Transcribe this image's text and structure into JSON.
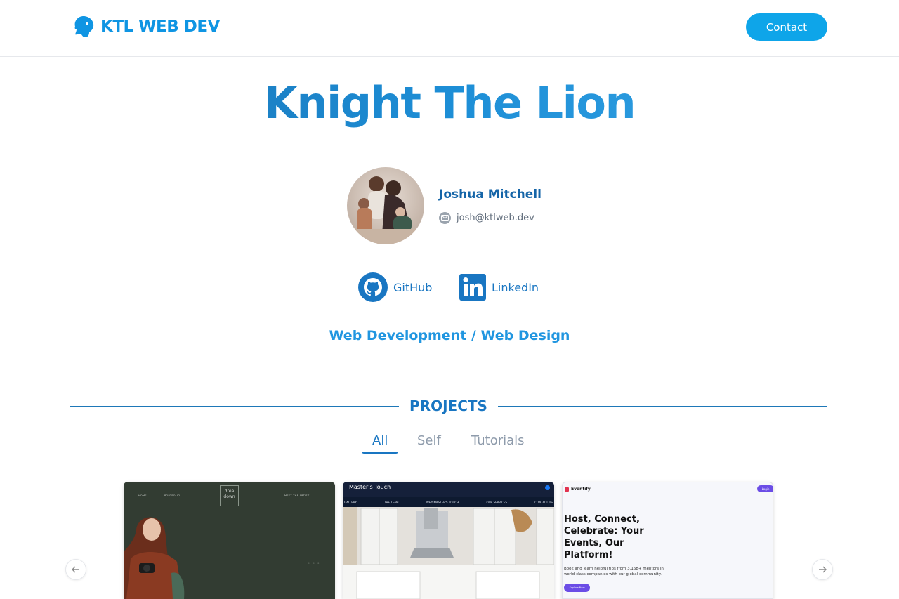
{
  "header": {
    "logo_text": "KTL WEB DEV",
    "contact_label": "Contact"
  },
  "hero": {
    "title": "Knight The Lion"
  },
  "profile": {
    "name": "Joshua Mitchell",
    "email": "josh@ktlweb.dev"
  },
  "socials": {
    "github_label": "GitHub",
    "linkedin_label": "LinkedIn"
  },
  "specialty": "Web Development / Web Design",
  "projects": {
    "section_title": "PROJECTS",
    "tabs": [
      {
        "label": "All",
        "active": true
      },
      {
        "label": "Self",
        "active": false
      },
      {
        "label": "Tutorials",
        "active": false
      }
    ],
    "cards": [
      {
        "nav_items": [
          "HOME",
          "PORTFOLIO",
          "MEET THE ARTIST"
        ],
        "logo": "drea down"
      },
      {
        "brand": "Master's Touch",
        "menu": [
          "GALLERY",
          "THE TEAM",
          "WHY MASTER'S TOUCH",
          "OUR SERVICES",
          "CONTACT US"
        ]
      },
      {
        "brand": "Eventify",
        "login_label": "Login",
        "headline": "Host, Connect, Celebrate: Your Events, Our Platform!",
        "body": "Book and learn helpful tips from 3,168+ mentors in world-class companies with our global community.",
        "cta_label": "Explore Now"
      }
    ]
  },
  "colors": {
    "brand_blue": "#0ea5e9",
    "heading_blue": "#1976c2",
    "muted_text": "#8e9bab"
  }
}
